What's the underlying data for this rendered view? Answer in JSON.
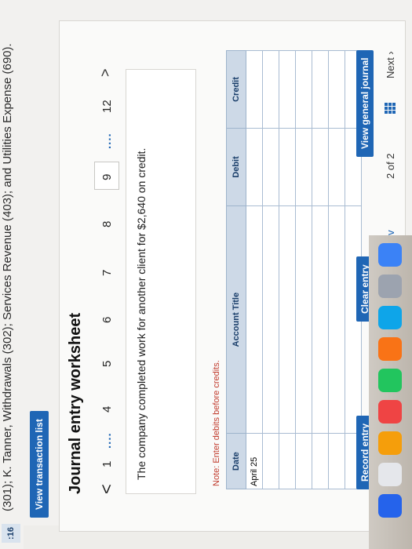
{
  "header": {
    "accounts_line": "(301); K. Tanner, Withdrawals (302); Services Revenue (403); and Utilities Expense (690).",
    "timer": ":16"
  },
  "toolbar": {
    "view_transaction_list": "View transaction list"
  },
  "worksheet": {
    "title": "Journal entry worksheet",
    "nav": {
      "prev_arrow": "<",
      "next_arrow": ">",
      "pages": [
        "1",
        "4",
        "5",
        "6",
        "7",
        "8",
        "9",
        "12"
      ],
      "dots": "....",
      "selected": "9"
    },
    "prompt": "The company completed work for another client for $2,640 on credit.",
    "note": "Note: Enter debits before credits.",
    "table": {
      "headers": [
        "Date",
        "Account Title",
        "Debit",
        "Credit"
      ],
      "rows": [
        {
          "date": "April 25",
          "account": "",
          "debit": "",
          "credit": ""
        },
        {
          "date": "",
          "account": "",
          "debit": "",
          "credit": ""
        },
        {
          "date": "",
          "account": "",
          "debit": "",
          "credit": ""
        },
        {
          "date": "",
          "account": "",
          "debit": "",
          "credit": ""
        },
        {
          "date": "",
          "account": "",
          "debit": "",
          "credit": ""
        },
        {
          "date": "",
          "account": "",
          "debit": "",
          "credit": ""
        },
        {
          "date": "",
          "account": "",
          "debit": "",
          "credit": ""
        }
      ]
    },
    "buttons": {
      "record": "Record entry",
      "clear": "Clear entry",
      "view_general_journal": "View general journal"
    }
  },
  "pagination": {
    "prev": "Prev",
    "position": "2 of 2",
    "next": "Next"
  },
  "colors": {
    "accent": "#1f66b5",
    "note": "#c0392b",
    "header_bg": "#cdd9e7"
  }
}
